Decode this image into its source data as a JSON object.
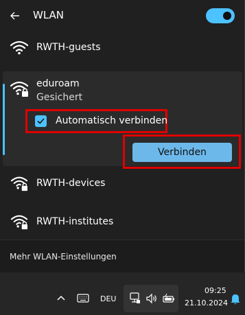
{
  "header": {
    "title": "WLAN",
    "toggle_state": "on"
  },
  "networks": [
    {
      "name": "RWTH-guests",
      "secured": false
    },
    {
      "name": "eduroam",
      "status": "Gesichert",
      "secured": true,
      "expanded": true
    },
    {
      "name": "RWTH-devices",
      "secured": true
    },
    {
      "name": "RWTH-institutes",
      "secured": true
    }
  ],
  "expanded_network": {
    "auto_connect_label": "Automatisch verbinden",
    "auto_connect_checked": true,
    "connect_label": "Verbinden"
  },
  "footer": {
    "link": "Mehr WLAN-Einstellungen"
  },
  "taskbar": {
    "language": "DEU",
    "time": "09:25",
    "date": "21.10.2024"
  },
  "colors": {
    "accent": "#4cc2ff",
    "connect_button": "#6cb8ea",
    "highlight_box": "#e00000",
    "panel": "#202020",
    "expanded_panel": "#2b2b2b"
  },
  "icons": [
    "back-arrow-icon",
    "wifi-icon",
    "wifi-lock-icon",
    "checkmark-icon",
    "chevron-up-icon",
    "keyboard-icon",
    "network-icon",
    "volume-icon",
    "battery-icon",
    "notification-bell-icon"
  ]
}
